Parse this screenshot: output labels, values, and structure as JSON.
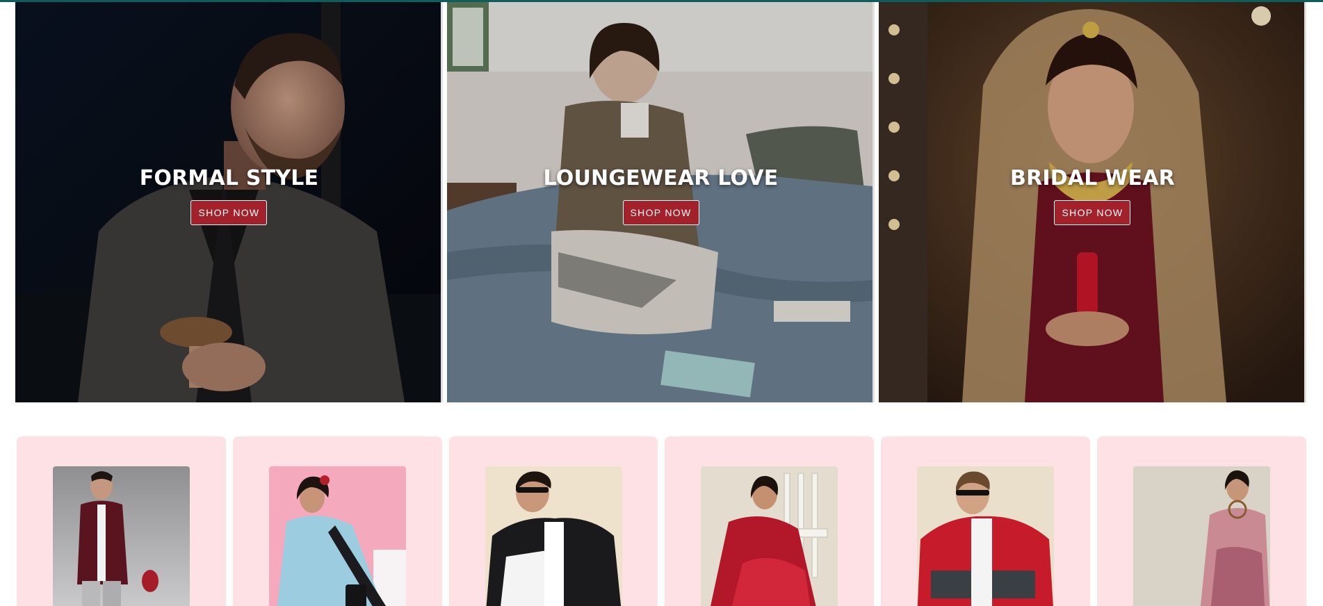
{
  "hero": [
    {
      "id": "formal",
      "title": "FORMAL STYLE",
      "button": "SHOP NOW",
      "icon": "man-in-blazer-photo"
    },
    {
      "id": "loungewear",
      "title": "LOUNGEWEAR LOVE",
      "button": "SHOP NOW",
      "icon": "woman-reading-on-bed-photo"
    },
    {
      "id": "bridal",
      "title": "BRIDAL WEAR",
      "button": "SHOP NOW",
      "icon": "bride-in-red-lehenga-photo"
    }
  ],
  "products": [
    {
      "id": "p1",
      "icon": "man-maroon-shirt-photo"
    },
    {
      "id": "p2",
      "icon": "woman-blue-saree-photo"
    },
    {
      "id": "p3",
      "icon": "man-puffer-jacket-photo"
    },
    {
      "id": "p4",
      "icon": "woman-red-saree-photo"
    },
    {
      "id": "p5",
      "icon": "man-red-jacket-photo"
    },
    {
      "id": "p6",
      "icon": "woman-pink-dress-photo"
    }
  ],
  "colors": {
    "accent": "#a3212b",
    "card_bg": "#fde1e5",
    "top_strip": "#0f5c5c"
  }
}
